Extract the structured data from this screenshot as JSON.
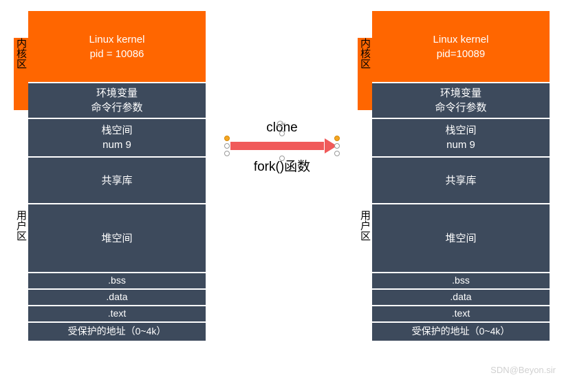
{
  "labels": {
    "kernel_zone": "内核区",
    "user_zone": "用户区",
    "clone": "clone",
    "fork": "fork()函数"
  },
  "left": {
    "kernel_line1": "Linux kernel",
    "kernel_line2": "pid = 10086",
    "env_line1": "环境变量",
    "env_line2": "命令行参数",
    "stack_line1": "栈空间",
    "stack_line2": "num 9",
    "shared": "共享库",
    "heap": "堆空间",
    "bss": ".bss",
    "data": ".data",
    "text": ".text",
    "protected": "受保护的地址（0~4k）"
  },
  "right": {
    "kernel_line1": "Linux kernel",
    "kernel_line2": "pid=10089",
    "env_line1": "环境变量",
    "env_line2": "命令行参数",
    "stack_line1": "栈空间",
    "stack_line2": "num 9",
    "shared": "共享库",
    "heap": "堆空间",
    "bss": ".bss",
    "data": ".data",
    "text": ".text",
    "protected": "受保护的地址（0~4k）"
  },
  "watermark": "SDN@Beyon.sir"
}
